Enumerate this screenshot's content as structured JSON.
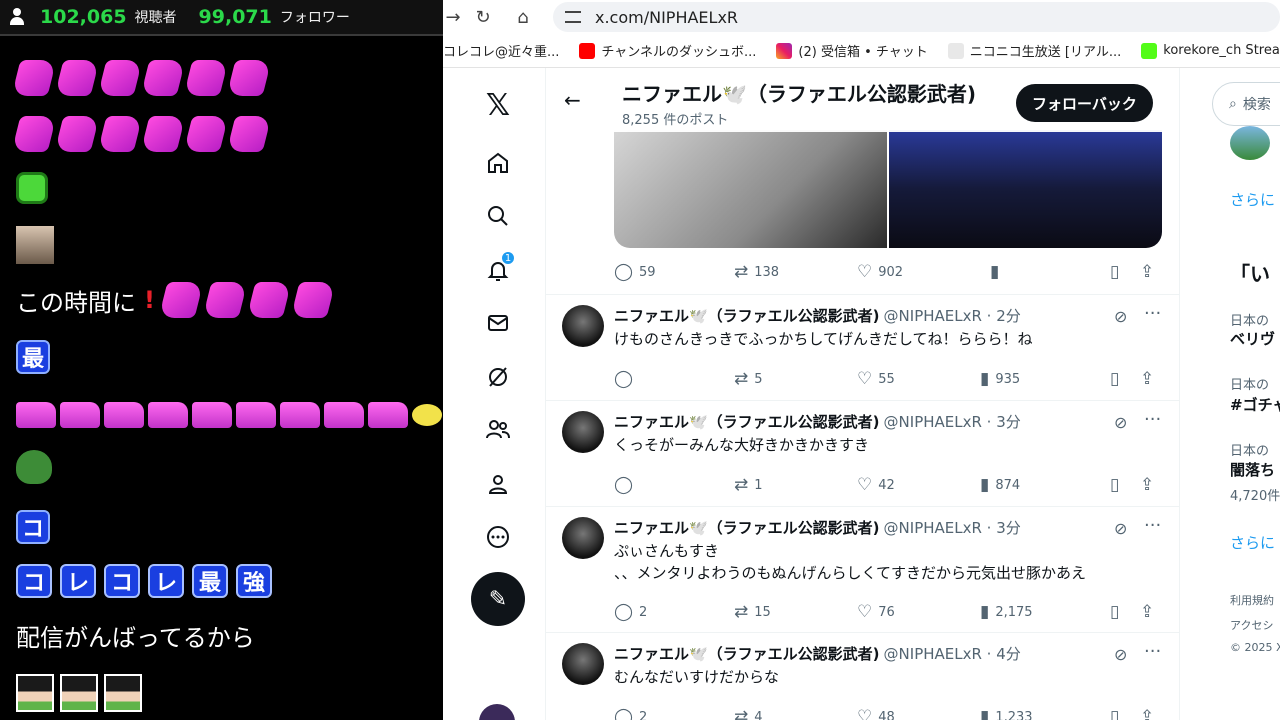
{
  "chat": {
    "viewers": "102,065",
    "viewers_label": "視聴者",
    "followers": "99,071",
    "followers_label": "フォロワー",
    "messages": [
      "この時間に",
      "最",
      "コ",
      "コ",
      "レ",
      "コ",
      "レ",
      "最",
      "強",
      "配信がんばってるから"
    ]
  },
  "browser": {
    "url": "x.com/NIPHAELxR",
    "bookmarks": [
      "コレコレ@近々重...",
      "チャンネルのダッシュボ...",
      "(2) 受信箱 • チャット",
      "ニコニコ生放送 [リアル...",
      "korekore_ch Stream..."
    ]
  },
  "x_nav": {
    "logo": "𝕏",
    "notification_count": "1"
  },
  "profile": {
    "name": "ニファエル🕊️（ラファエル公認影武者)",
    "post_count": "8,255 件のポスト",
    "follow_back": "フォローバック"
  },
  "first_post_actions": {
    "replies": "59",
    "reposts": "138",
    "likes": "902"
  },
  "tweets": [
    {
      "name": "ニファエル🕊️（ラファエル公認影武者)",
      "handle": "@NIPHAELxR · 2分",
      "lines": [
        "けものさんきっきでふっかちしてげんきだしてね！ららら！ね"
      ],
      "replies": "",
      "reposts": "5",
      "likes": "55",
      "views": "935"
    },
    {
      "name": "ニファエル🕊️（ラファエル公認影武者)",
      "handle": "@NIPHAELxR · 3分",
      "lines": [
        "くっそがーみんな大好きかきかきすき"
      ],
      "replies": "",
      "reposts": "1",
      "likes": "42",
      "views": "874"
    },
    {
      "name": "ニファエル🕊️（ラファエル公認影武者)",
      "handle": "@NIPHAELxR · 3分",
      "lines": [
        "ぷぃさんもすき",
        "、、メンタリよわうのもぬんげんらしくてすきだから元気出せ豚かあえ"
      ],
      "replies": "2",
      "reposts": "15",
      "likes": "76",
      "views": "2,175"
    },
    {
      "name": "ニファエル🕊️（ラファエル公認影武者)",
      "handle": "@NIPHAELxR · 4分",
      "lines": [
        "むんなだいすけだからな"
      ],
      "replies": "2",
      "reposts": "4",
      "likes": "48",
      "views": "1,233"
    }
  ],
  "right": {
    "search_placeholder": "検索",
    "show_more": "さらに",
    "trend_title": "「い",
    "trends": [
      {
        "meta": "日本の",
        "topic": "ベリヴ"
      },
      {
        "meta": "日本の",
        "topic": "#ゴチャ"
      },
      {
        "meta": "日本の",
        "topic": "闇落ち",
        "count": "4,720件"
      }
    ],
    "show_more_2": "さらに",
    "footer": [
      "利用規約",
      "アクセシ",
      "© 2025 X"
    ]
  }
}
